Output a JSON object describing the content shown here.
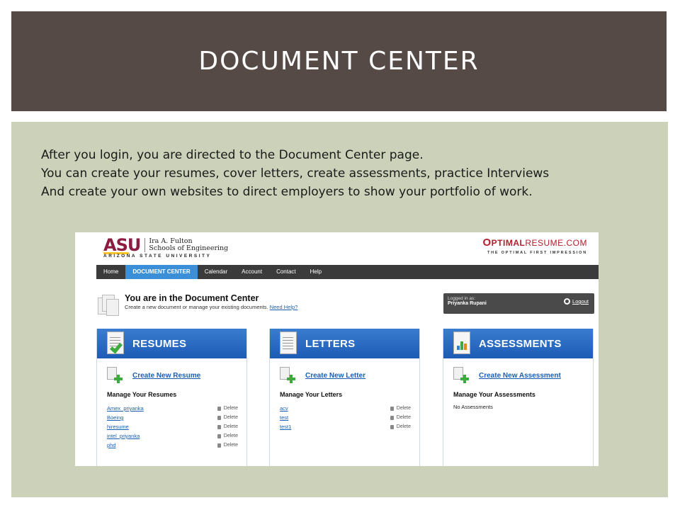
{
  "slide": {
    "title": "DOCUMENT CENTER",
    "intro": [
      "After you login, you are directed to the Document Center page.",
      "You can create your resumes, cover letters, create assessments, practice Interviews",
      "And create your own websites to direct employers to show your portfolio of work."
    ]
  },
  "app": {
    "asu": {
      "mark": "ASU",
      "school_line1": "Ira A. Fulton",
      "school_line2": "Schools of Engineering",
      "university": "ARIZONA STATE UNIVERSITY"
    },
    "brand": {
      "o": "O",
      "optimal": "PTIMAL",
      "resume": "RESUME.COM",
      "tagline": "THE OPTIMAL FIRST IMPRESSION"
    },
    "nav": [
      {
        "label": "Home"
      },
      {
        "label": "DOCUMENT CENTER",
        "active": true
      },
      {
        "label": "Calendar"
      },
      {
        "label": "Account"
      },
      {
        "label": "Contact"
      },
      {
        "label": "Help"
      }
    ],
    "heading": {
      "title": "You are in the Document Center",
      "subtitle": "Create a new document or manage your existing documents.",
      "help_link": "Need Help?"
    },
    "login": {
      "label": "Logged in as:",
      "user": "Priyanka Rupani",
      "logout": "Logout"
    },
    "panels": {
      "resumes": {
        "title": "RESUMES",
        "create": "Create New Resume",
        "manage": "Manage Your Resumes",
        "items": [
          "Amex_priyanka",
          "Boeing",
          "hiresume",
          "intel_priyanka",
          "phd"
        ],
        "delete_label": "Delete"
      },
      "letters": {
        "title": "LETTERS",
        "create": "Create New Letter",
        "manage": "Manage Your Letters",
        "items": [
          "acv",
          "test",
          "test1"
        ],
        "delete_label": "Delete"
      },
      "assessments": {
        "title": "ASSESSMENTS",
        "create": "Create New Assessment",
        "manage": "Manage Your Assessments",
        "empty": "No Assessments"
      }
    },
    "colors": {
      "header_bg": "#564a47",
      "content_bg": "#ccd1b9",
      "panel_blue": "#1d5bb5",
      "nav_active": "#3b8fd6",
      "link": "#1a5fb4",
      "asu_maroon": "#8c1d40",
      "asu_gold": "#ffc627"
    }
  }
}
